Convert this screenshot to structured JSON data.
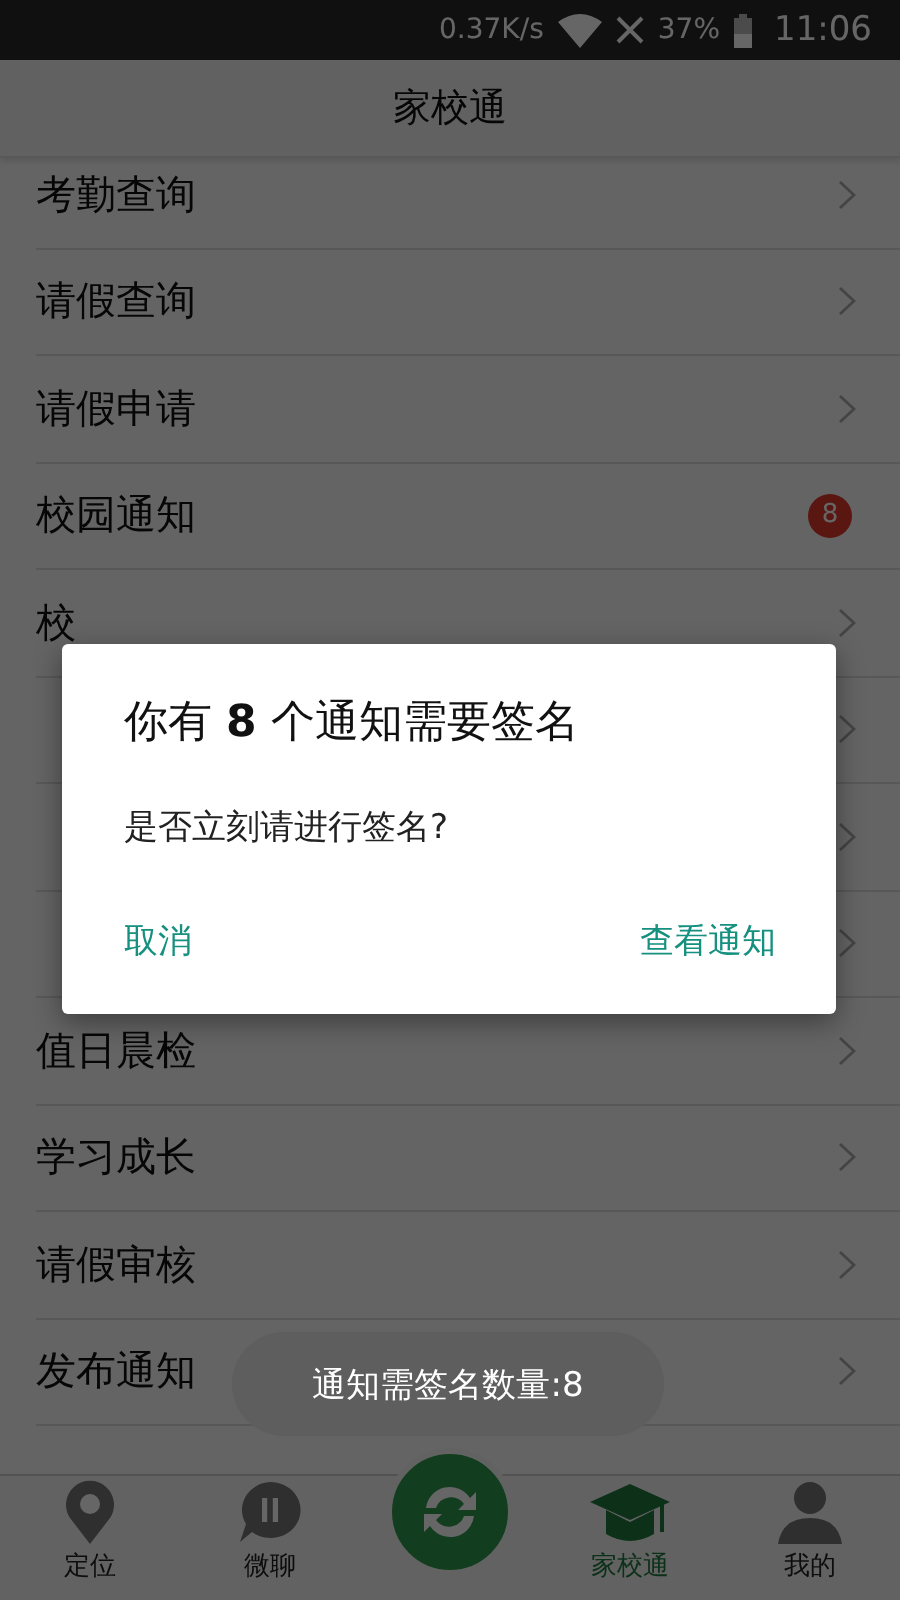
{
  "status_bar": {
    "speed": "0.37K/s",
    "battery": "37%",
    "time": "11:06"
  },
  "header": {
    "title": "家校通"
  },
  "menu": [
    {
      "label": "考勤查询"
    },
    {
      "label": "请假查询"
    },
    {
      "label": "请假申请"
    },
    {
      "label": "校园通知",
      "badge": "8"
    },
    {
      "label": "校"
    },
    {
      "chevron": true
    },
    {
      "chevron": true
    },
    {
      "chevron": true
    },
    {
      "label": "值日晨检"
    },
    {
      "label": "学习成长"
    },
    {
      "label": "请假审核"
    },
    {
      "label": "发布通知"
    }
  ],
  "dialog": {
    "title": "你有 **8** 个通知需要签名",
    "message": "是否立刻请进行签名?",
    "buttons": [
      "取消",
      "查看通知"
    ]
  },
  "toast": {
    "text": "通知需签名数量:8"
  },
  "nav": [
    {
      "kind": "tab",
      "label": "定位",
      "selected": false
    },
    {
      "kind": "tab",
      "label": "微聊",
      "selected": false
    },
    {
      "kind": "fab"
    },
    {
      "kind": "tab",
      "label": "家校通",
      "selected": true
    },
    {
      "kind": "tab",
      "label": "我的",
      "selected": false
    }
  ]
}
